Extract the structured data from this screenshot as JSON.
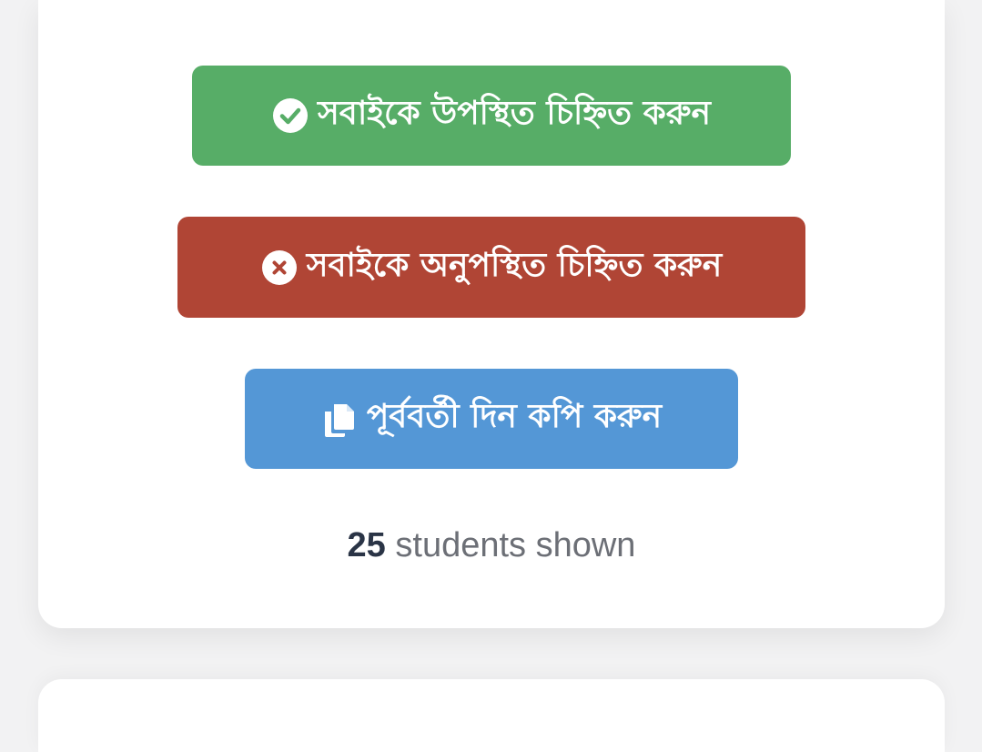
{
  "actions": {
    "mark_all_present_label": "সবাইকে উপস্থিত চিহ্নিত করুন",
    "mark_all_absent_label": "সবাইকে অনুপস্থিত চিহ্নিত করুন",
    "copy_previous_day_label": "পূর্ববর্তী দিন কপি করুন"
  },
  "summary": {
    "count": "25",
    "suffix": " students shown"
  },
  "icons": {
    "present": "check-circle-icon",
    "absent": "x-circle-icon",
    "copy": "copy-icon"
  },
  "colors": {
    "present": "#57ad67",
    "absent": "#b04535",
    "copy": "#5497d6"
  }
}
